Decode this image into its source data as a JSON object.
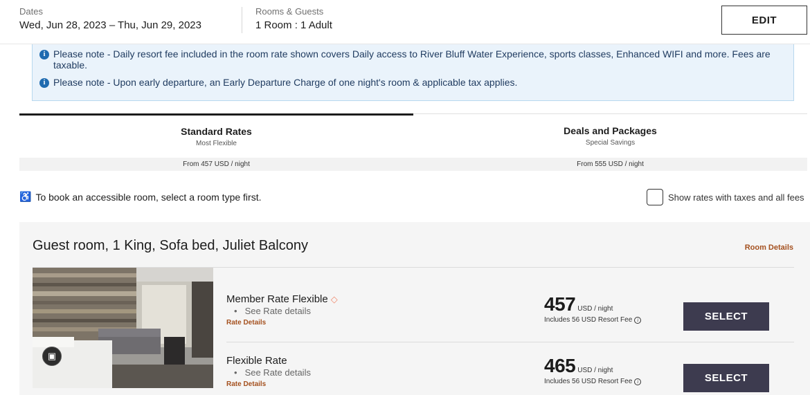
{
  "header": {
    "dates_label": "Dates",
    "dates_value": "Wed, Jun 28, 2023 – Thu, Jun 29, 2023",
    "rooms_label": "Rooms & Guests",
    "rooms_value": "1 Room : 1 Adult",
    "edit_label": "EDIT"
  },
  "notices": [
    {
      "icon": "info-icon",
      "text": "Please note - Daily resort fee included in the room rate shown covers Daily access to River Bluff Water Experience, sports classes, Enhanced WIFI and more. Fees are taxable."
    },
    {
      "icon": "info-icon",
      "text": "Please note - Upon early departure, an Early Departure Charge of one night's room & applicable tax applies."
    }
  ],
  "tabs": [
    {
      "title": "Standard Rates",
      "subtitle": "Most Flexible",
      "from": "From 457 USD / night",
      "active": true
    },
    {
      "title": "Deals and Packages",
      "subtitle": "Special Savings",
      "from": "From 555 USD / night",
      "active": false
    }
  ],
  "accessible_note": "To book an accessible room, select a room type first.",
  "taxes_toggle_label": "Show rates with taxes and all fees",
  "room": {
    "title": "Guest room, 1 King, Sofa bed, Juliet Balcony",
    "details_link": "Room Details",
    "rates": [
      {
        "name": "Member Rate Flexible",
        "has_tag_icon": true,
        "bullet": "See Rate details",
        "details_link": "Rate Details",
        "price": "457",
        "unit": "USD / night",
        "fee_note": "Includes 56 USD Resort Fee",
        "select_label": "SELECT"
      },
      {
        "name": "Flexible Rate",
        "has_tag_icon": false,
        "bullet": "See Rate details",
        "details_link": "Rate Details",
        "price": "465",
        "unit": "USD / night",
        "fee_note": "Includes 56 USD Resort Fee",
        "select_label": "SELECT"
      }
    ]
  },
  "colors": {
    "accent_link": "#a4501e",
    "select_button": "#3d3b4f",
    "notice_bg": "#eaf3fb",
    "info_icon": "#1f6bb0"
  }
}
